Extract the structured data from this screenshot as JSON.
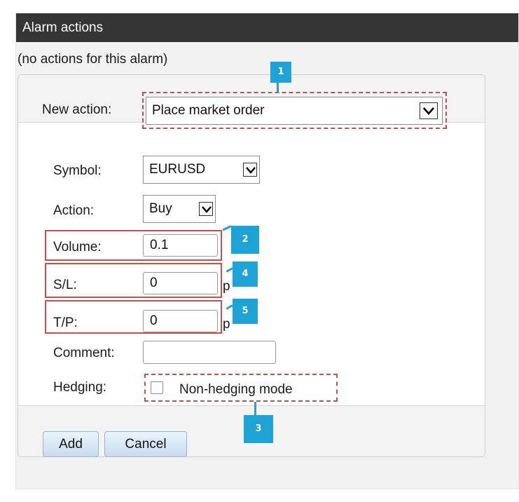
{
  "window": {
    "title": "Alarm actions"
  },
  "status_text": "(no actions for this alarm)",
  "new_action": {
    "label": "New action:",
    "selected": "Place market order"
  },
  "form": {
    "symbol": {
      "label": "Symbol:",
      "selected": "EURUSD"
    },
    "action": {
      "label": "Action:",
      "selected": "Buy"
    },
    "volume": {
      "label": "Volume:",
      "value": "0.1"
    },
    "sl": {
      "label": "S/L:",
      "value": "0",
      "unit": "p"
    },
    "tp": {
      "label": "T/P:",
      "value": "0",
      "unit": "p"
    },
    "comment": {
      "label": "Comment:",
      "value": ""
    },
    "hedging": {
      "label": "Hedging:",
      "checkbox_label": "Non-hedging mode",
      "checked": false
    }
  },
  "buttons": {
    "add": "Add",
    "cancel": "Cancel"
  },
  "markers": [
    "1",
    "2",
    "3",
    "4",
    "5"
  ],
  "colors": {
    "title_bar": "#353535",
    "highlight": "#c0504d",
    "marker": "#1ea3d6"
  },
  "icons": {
    "dropdown": "chevron-down-icon"
  }
}
